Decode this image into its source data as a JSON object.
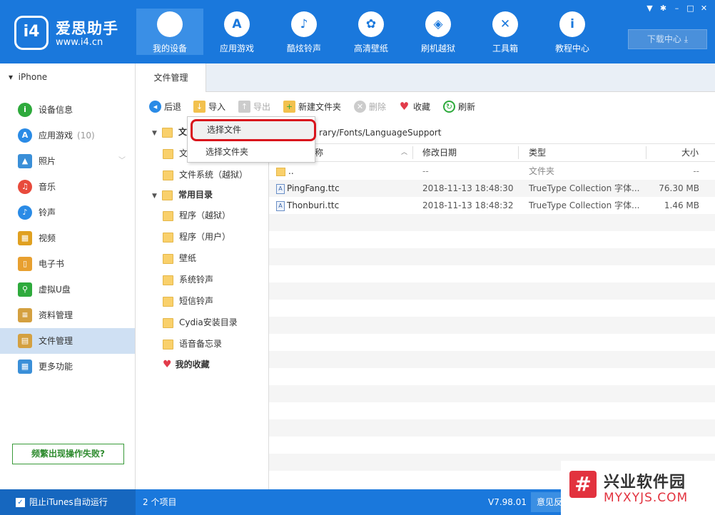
{
  "header": {
    "brand": "爱思助手",
    "url": "www.i4.cn",
    "nav": [
      {
        "label": "我的设备",
        "icon": "apple-icon"
      },
      {
        "label": "应用游戏",
        "icon": "appstore-icon"
      },
      {
        "label": "酷炫铃声",
        "icon": "bell-icon"
      },
      {
        "label": "高清壁纸",
        "icon": "flower-icon"
      },
      {
        "label": "刷机越狱",
        "icon": "dropbox-icon"
      },
      {
        "label": "工具箱",
        "icon": "tools-icon"
      },
      {
        "label": "教程中心",
        "icon": "info-icon"
      }
    ],
    "download_center": "下载中心"
  },
  "sidebar": {
    "device": "iPhone",
    "items": [
      {
        "label": "设备信息",
        "icon": "info-icon",
        "color": "#2eaa3c"
      },
      {
        "label": "应用游戏",
        "count": "(10)",
        "icon": "appstore-icon",
        "color": "#2a8be6"
      },
      {
        "label": "照片",
        "icon": "photo-icon",
        "color": "#3a8fd8"
      },
      {
        "label": "音乐",
        "icon": "music-icon",
        "color": "#e84b3c"
      },
      {
        "label": "铃声",
        "icon": "bell-icon",
        "color": "#2a8be6"
      },
      {
        "label": "视频",
        "icon": "film-icon",
        "color": "#e0a020"
      },
      {
        "label": "电子书",
        "icon": "book-icon",
        "color": "#e8a030"
      },
      {
        "label": "虚拟U盘",
        "icon": "usb-icon",
        "color": "#2eaa3c"
      },
      {
        "label": "资料管理",
        "icon": "contacts-icon",
        "color": "#d4a040"
      },
      {
        "label": "文件管理",
        "icon": "files-icon",
        "color": "#d4a040"
      },
      {
        "label": "更多功能",
        "icon": "grid-icon",
        "color": "#3a8fd8"
      }
    ],
    "fail_button": "频繁出现操作失败?"
  },
  "main": {
    "tab": "文件管理",
    "toolbar": {
      "back": "后退",
      "import": "导入",
      "export": "导出",
      "new_folder": "新建文件夹",
      "delete": "删除",
      "favorite": "收藏",
      "refresh": "刷新"
    },
    "tree": {
      "root_partial": "文",
      "child_partial": "文",
      "system_jb": "文件系统（越狱）",
      "common": "常用目录",
      "items": [
        "程序（越狱）",
        "程序（用户）",
        "壁纸",
        "系统铃声",
        "短信铃声",
        "Cydia安装目录",
        "语音备忘录"
      ],
      "favorites": "我的收藏"
    },
    "path": "rary/Fonts/LanguageSupport",
    "columns": {
      "name": "称",
      "date": "修改日期",
      "type": "类型",
      "size": "大小"
    },
    "rows": [
      {
        "name": "..",
        "date": "--",
        "type": "文件夹",
        "size": "--"
      },
      {
        "name": "PingFang.ttc",
        "date": "2018-11-13 18:48:30",
        "type": "TrueType Collection 字体...",
        "size": "76.30 MB"
      },
      {
        "name": "Thonburi.ttc",
        "date": "2018-11-13 18:48:32",
        "type": "TrueType Collection 字体...",
        "size": "1.46 MB"
      }
    ],
    "menu": {
      "select_file": "选择文件",
      "select_folder": "选择文件夹"
    }
  },
  "status": {
    "itunes": "阻止iTunes自动运行",
    "count": "2 个项目",
    "version": "V7.98.01",
    "feedback": "意见反"
  },
  "watermark": {
    "title": "兴业软件园",
    "url": "MYXYJS.COM"
  }
}
